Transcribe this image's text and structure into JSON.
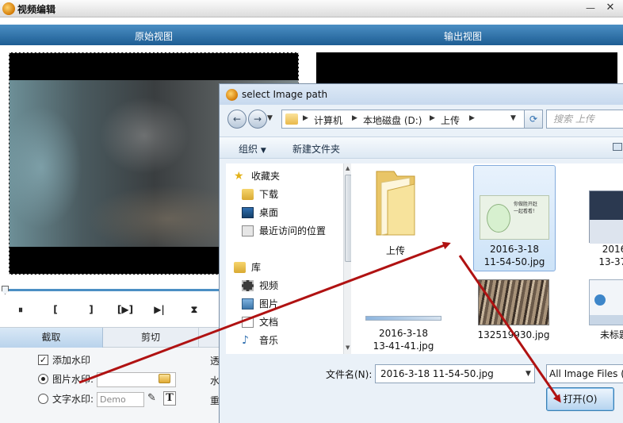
{
  "editor": {
    "title": "视频编辑",
    "original_view_label": "原始视图",
    "output_view_label": "输出视图",
    "controls": [
      "⏸",
      "[",
      "]",
      "[▶]",
      "▶|",
      "⧗"
    ],
    "tabs": [
      "截取",
      "剪切",
      ""
    ],
    "watermark": {
      "add_watermark_label": "添加水印",
      "image_watermark_label": "图片水印:",
      "text_watermark_label": "文字水印:",
      "text_watermark_value": "Demo",
      "side_labels": [
        "透",
        "水",
        "重"
      ]
    }
  },
  "dialog": {
    "title": "select Image path",
    "breadcrumb": [
      "计算机",
      "本地磁盘 (D:)",
      "上传"
    ],
    "search_placeholder": "搜索 上传",
    "toolbar": {
      "organize": "组织",
      "new_folder": "新建文件夹"
    },
    "nav": {
      "favorites": "收藏夹",
      "favorites_items": [
        "下载",
        "桌面",
        "最近访问的位置"
      ],
      "libraries": "库",
      "library_items": [
        "视频",
        "图片",
        "文档",
        "音乐"
      ]
    },
    "files": [
      {
        "name": "上传"
      },
      {
        "name": "2016-3-18\n11-54-50.jpg",
        "selected": true
      },
      {
        "name": "2016\n13-37-"
      },
      {
        "name": "2016-3-18\n13-41-41.jpg"
      },
      {
        "name": "132519930.jpg"
      },
      {
        "name": "未标题"
      }
    ],
    "thumbnail_text": "你做胜开赶\n一起看看！",
    "filename_label": "文件名(N):",
    "filename_value": "2016-3-18 11-54-50.jpg",
    "filter_value": "All Image Files (",
    "open_button": "打开(O)"
  },
  "colors": {
    "header_blue": "#1e5d93",
    "arrow_red": "#b01212",
    "selection": "#cde3f8"
  }
}
